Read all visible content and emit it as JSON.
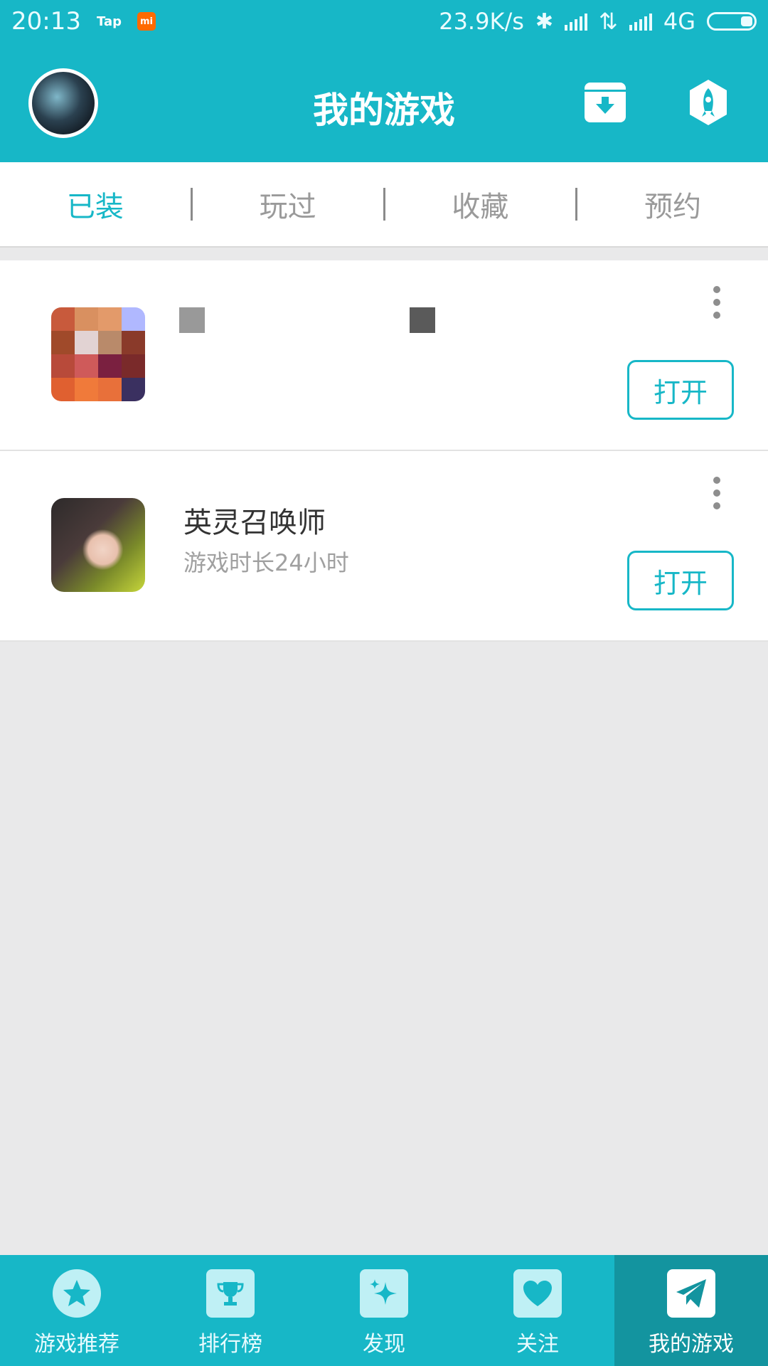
{
  "status_bar": {
    "time": "20:13",
    "app_badge": "Tap",
    "mi_badge": "mi",
    "network_speed": "23.9K/s",
    "network_type": "4G"
  },
  "header": {
    "title": "我的游戏"
  },
  "tabs": [
    {
      "label": "已装",
      "active": true
    },
    {
      "label": "玩过",
      "active": false
    },
    {
      "label": "收藏",
      "active": false
    },
    {
      "label": "预约",
      "active": false
    }
  ],
  "games": [
    {
      "name": "",
      "meta": "",
      "button": "打开"
    },
    {
      "name": "英灵召唤师",
      "meta": "游戏时长24小时",
      "button": "打开"
    }
  ],
  "bottom_nav": [
    {
      "label": "游戏推荐",
      "icon": "star-icon",
      "active": false
    },
    {
      "label": "排行榜",
      "icon": "trophy-icon",
      "active": false
    },
    {
      "label": "发现",
      "icon": "sparkle-icon",
      "active": false
    },
    {
      "label": "关注",
      "icon": "heart-icon",
      "active": false
    },
    {
      "label": "我的游戏",
      "icon": "paper-plane-icon",
      "active": true
    }
  ],
  "colors": {
    "primary": "#17b7c7",
    "active_nav": "#13949f",
    "background": "#e9e9ea"
  }
}
